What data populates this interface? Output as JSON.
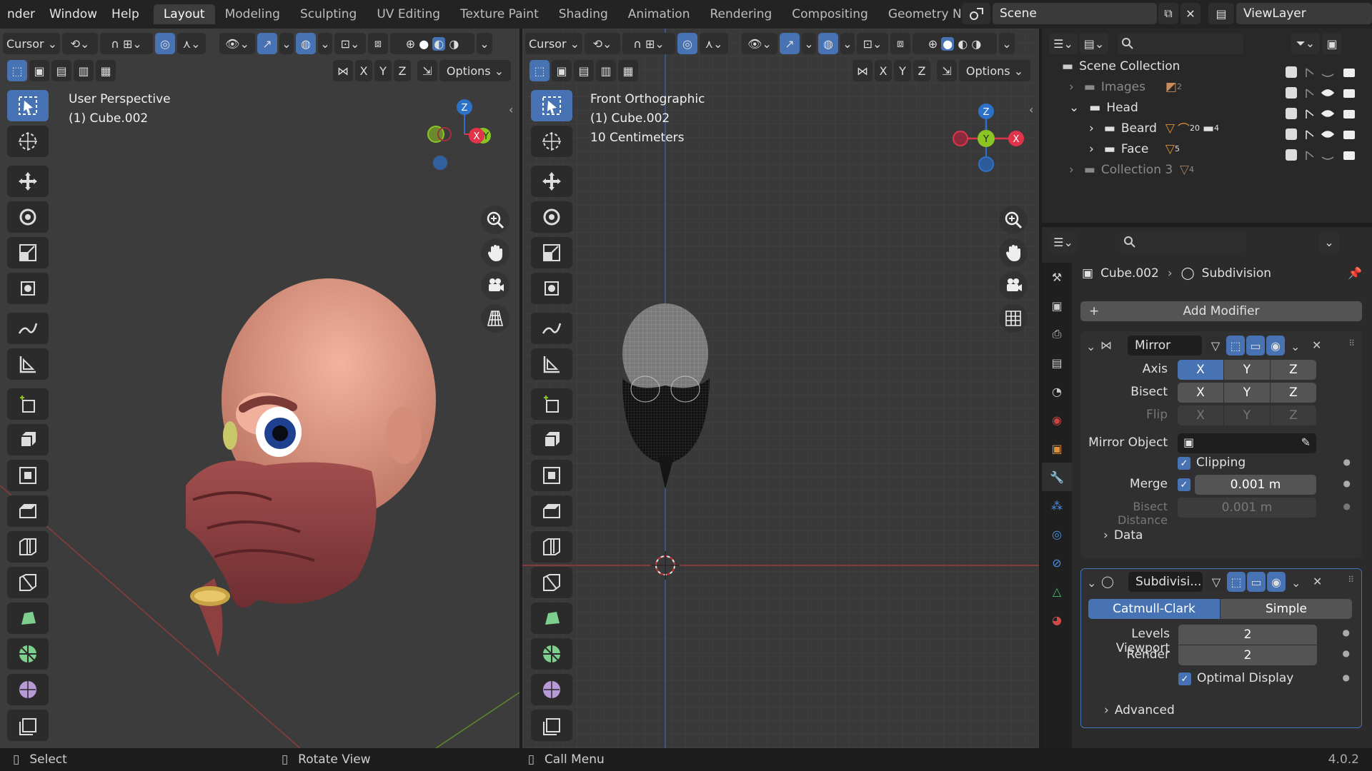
{
  "menu": [
    "nder",
    "Window",
    "Help"
  ],
  "workspaces": [
    "Layout",
    "Modeling",
    "Sculpting",
    "UV Editing",
    "Texture Paint",
    "Shading",
    "Animation",
    "Rendering",
    "Compositing",
    "Geometry Nodes"
  ],
  "active_workspace": "Layout",
  "scene": {
    "name": "Scene",
    "view_layer": "ViewLayer"
  },
  "viewport_left": {
    "transform_label": "Cursor",
    "options_label": "Options",
    "view_name": "User Perspective",
    "object_line": "(1) Cube.002",
    "axis_labels": {
      "x": "X",
      "y": "Y",
      "z": "Z"
    }
  },
  "viewport_right": {
    "transform_label": "Cursor",
    "options_label": "Options",
    "view_name": "Front Orthographic",
    "object_line": "(1) Cube.002",
    "scale_line": "10 Centimeters",
    "axis_labels": {
      "x": "X",
      "y": "Y",
      "z": "Z"
    }
  },
  "outliner": {
    "root": "Scene Collection",
    "items": [
      {
        "label": "Images",
        "badge": "2",
        "dim": true
      },
      {
        "label": "Head",
        "dim": false
      },
      {
        "label": "Beard",
        "badge": "20",
        "badge2": "4",
        "dim": false
      },
      {
        "label": "Face",
        "badge": "5",
        "dim": false
      },
      {
        "label": "Collection 3",
        "badge": "4",
        "dim": true
      }
    ]
  },
  "properties": {
    "breadcrumb_object": "Cube.002",
    "breadcrumb_modifier": "Subdivision",
    "add_modifier": "Add Modifier",
    "mirror": {
      "name": "Mirror",
      "axis_label": "Axis",
      "bisect_label": "Bisect",
      "flip_label": "Flip",
      "axes": [
        "X",
        "Y",
        "Z"
      ],
      "mirror_object_label": "Mirror Object",
      "clipping_label": "Clipping",
      "merge_label": "Merge",
      "merge_value": "0.001 m",
      "bisect_distance_label": "Bisect Distance",
      "bisect_distance_value": "0.001 m",
      "data_label": "Data"
    },
    "subdivision": {
      "name": "Subdivisi...",
      "catmull": "Catmull-Clark",
      "simple": "Simple",
      "levels_viewport_label": "Levels Viewport",
      "levels_viewport_value": "2",
      "render_label": "Render",
      "render_value": "2",
      "optimal_label": "Optimal Display",
      "advanced_label": "Advanced"
    }
  },
  "status": {
    "select": "Select",
    "rotate": "Rotate View",
    "menu": "Call Menu",
    "version": "4.0.2"
  },
  "colors": {
    "accent": "#4772b3",
    "axis_x": "#e0344b",
    "axis_y": "#8ac523",
    "axis_z": "#2c72c9"
  }
}
